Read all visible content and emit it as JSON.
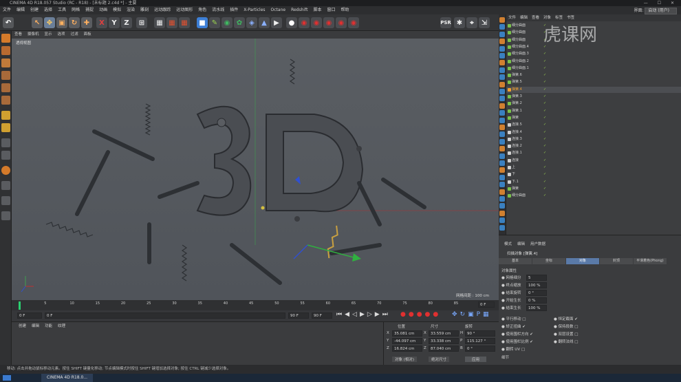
{
  "window": {
    "title": "CINEMA 4D R18.057 Studio (RC - R18) - [未标题 2.c4d *] - 主要"
  },
  "menu": {
    "items": [
      "文件",
      "编辑",
      "创建",
      "选择",
      "工具",
      "网格",
      "捕捉",
      "动画",
      "模拟",
      "渲染",
      "雕刻",
      "运动跟踪",
      "运动图形",
      "角色",
      "流水线",
      "插件",
      "X-Particles",
      "Octane",
      "Redshift",
      "脚本",
      "窗口",
      "帮助"
    ],
    "layout_label": "界面:",
    "layout_value": "启动 (用户)"
  },
  "viewport": {
    "menu": [
      "查看",
      "摄像机",
      "显示",
      "选项",
      "过滤",
      "面板"
    ],
    "camera_label": "透视视图",
    "grid_label": "网格间距 : 100 cm"
  },
  "timeline": {
    "ticks": [
      "0",
      "5",
      "10",
      "15",
      "20",
      "25",
      "30",
      "35",
      "40",
      "45",
      "50",
      "55",
      "60",
      "65",
      "70",
      "75",
      "80",
      "85",
      "90"
    ],
    "end_frame_field": "0 F"
  },
  "playback": {
    "current_frame": "0 F",
    "start_field": "0 F",
    "end_field": "90 F",
    "end_field2": "90 F"
  },
  "materials": {
    "menu": [
      "创建",
      "编辑",
      "功能",
      "纹理"
    ]
  },
  "coords": {
    "headers": [
      "位置",
      "尺寸",
      "旋转"
    ],
    "x": {
      "pos": "35.081 cm",
      "size": "33.559 cm",
      "rot": "90 °",
      "rot_label": "H"
    },
    "y": {
      "pos": "-44.097 cm",
      "size": "33.338 cm",
      "rot": "115.127 °",
      "rot_label": "P"
    },
    "z": {
      "pos": "16.824 cm",
      "size": "87.040 cm",
      "rot": "0 °",
      "rot_label": "B"
    },
    "mode_select": "对象 (相对)",
    "size_select": "绝对尺寸",
    "apply_button": "应用"
  },
  "object_manager": {
    "menu": [
      "文件",
      "编辑",
      "查看",
      "对象",
      "标签",
      "书签"
    ],
    "rows": [
      {
        "name": "细分曲面",
        "color": "#79c14a"
      },
      {
        "name": "细分曲面",
        "color": "#79c14a"
      },
      {
        "name": "细分曲面",
        "color": "#79c14a"
      },
      {
        "name": "细分曲面.4",
        "color": "#79c14a"
      },
      {
        "name": "细分曲面.3",
        "color": "#79c14a"
      },
      {
        "name": "细分曲面.2",
        "color": "#79c14a"
      },
      {
        "name": "细分曲面.1",
        "color": "#79c14a"
      },
      {
        "name": "弹簧.6",
        "color": "#79c14a"
      },
      {
        "name": "弹簧.5",
        "color": "#79c14a"
      },
      {
        "name": "弹簧.4",
        "color": "#f0a030"
      },
      {
        "name": "弹簧.3",
        "color": "#79c14a"
      },
      {
        "name": "弹簧.2",
        "color": "#79c14a"
      },
      {
        "name": "弹簧.1",
        "color": "#79c14a"
      },
      {
        "name": "弹簧",
        "color": "#79c14a"
      },
      {
        "name": "连接.5",
        "color": "#cfcfcf"
      },
      {
        "name": "连接.4",
        "color": "#cfcfcf"
      },
      {
        "name": "连接.3",
        "color": "#cfcfcf"
      },
      {
        "name": "连接.2",
        "color": "#cfcfcf"
      },
      {
        "name": "连接.1",
        "color": "#cfcfcf"
      },
      {
        "name": "连接",
        "color": "#cfcfcf"
      },
      {
        "name": "上",
        "color": "#cfcfcf"
      },
      {
        "name": "下",
        "color": "#cfcfcf"
      },
      {
        "name": "下.1",
        "color": "#cfcfcf"
      },
      {
        "name": "弹簧",
        "color": "#79c14a"
      },
      {
        "name": "细分曲面",
        "color": "#79c14a"
      }
    ]
  },
  "attributes": {
    "menu": [
      "模式",
      "编辑",
      "用户数据"
    ],
    "object_title": "扫描对象 [弹簧.4]",
    "tabs": [
      "基本",
      "坐标",
      "对象",
      "封顶",
      "平滑着色(Phong)"
    ],
    "active_tab": "对象",
    "section": "对象属性",
    "fields": [
      {
        "label": "网格细分",
        "value": "5"
      },
      {
        "label": "终点缩放",
        "value": "100 %"
      },
      {
        "label": "结束旋转",
        "value": "0 °"
      },
      {
        "label": "开始生长",
        "value": "0 %"
      },
      {
        "label": "结束生长",
        "value": "100 %"
      }
    ],
    "checks_left": [
      {
        "label": "平行移动",
        "checked": false
      },
      {
        "label": "矫正扭曲",
        "checked": true
      },
      {
        "label": "使用围栏方向",
        "checked": true
      },
      {
        "label": "使用围栏比例",
        "checked": true
      },
      {
        "label": "翻转 UV",
        "checked": false
      }
    ],
    "checks_right": [
      {
        "label": "恒定截面",
        "checked": true
      },
      {
        "label": "保持段数",
        "checked": false
      },
      {
        "label": "双层设置",
        "checked": false
      },
      {
        "label": "翻转法线",
        "checked": false
      }
    ],
    "detail_label": "细节"
  },
  "status": {
    "text": "移动: 点击并拖动鼠标移动元素。按住 SHIFT 键量化移动; 节点编辑模式时按住 SHIFT 键增加选择对象; 按住 CTRL 键减少选择对象。"
  },
  "taskbar": {
    "app_label": "CINEMA 4D R18.0..."
  },
  "watermark": {
    "text": "虎课网"
  }
}
